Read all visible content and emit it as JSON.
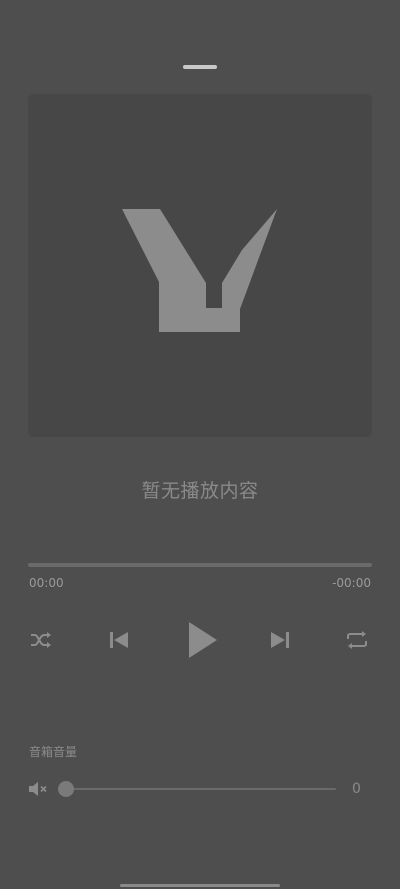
{
  "player": {
    "title": "暂无播放内容",
    "time_elapsed": "00:00",
    "time_remaining": "-00:00",
    "progress": 0
  },
  "controls": {
    "shuffle_icon": "shuffle-icon",
    "prev_icon": "skip-previous-icon",
    "play_icon": "play-icon",
    "next_icon": "skip-next-icon",
    "repeat_icon": "repeat-icon"
  },
  "volume": {
    "label": "音箱音量",
    "value": "0",
    "icon": "speaker-mute-icon"
  },
  "colors": {
    "background": "#4e4e4e",
    "artwork_bg": "#474747",
    "logo": "#8c8c8c",
    "icon": "#8c8c8c"
  }
}
